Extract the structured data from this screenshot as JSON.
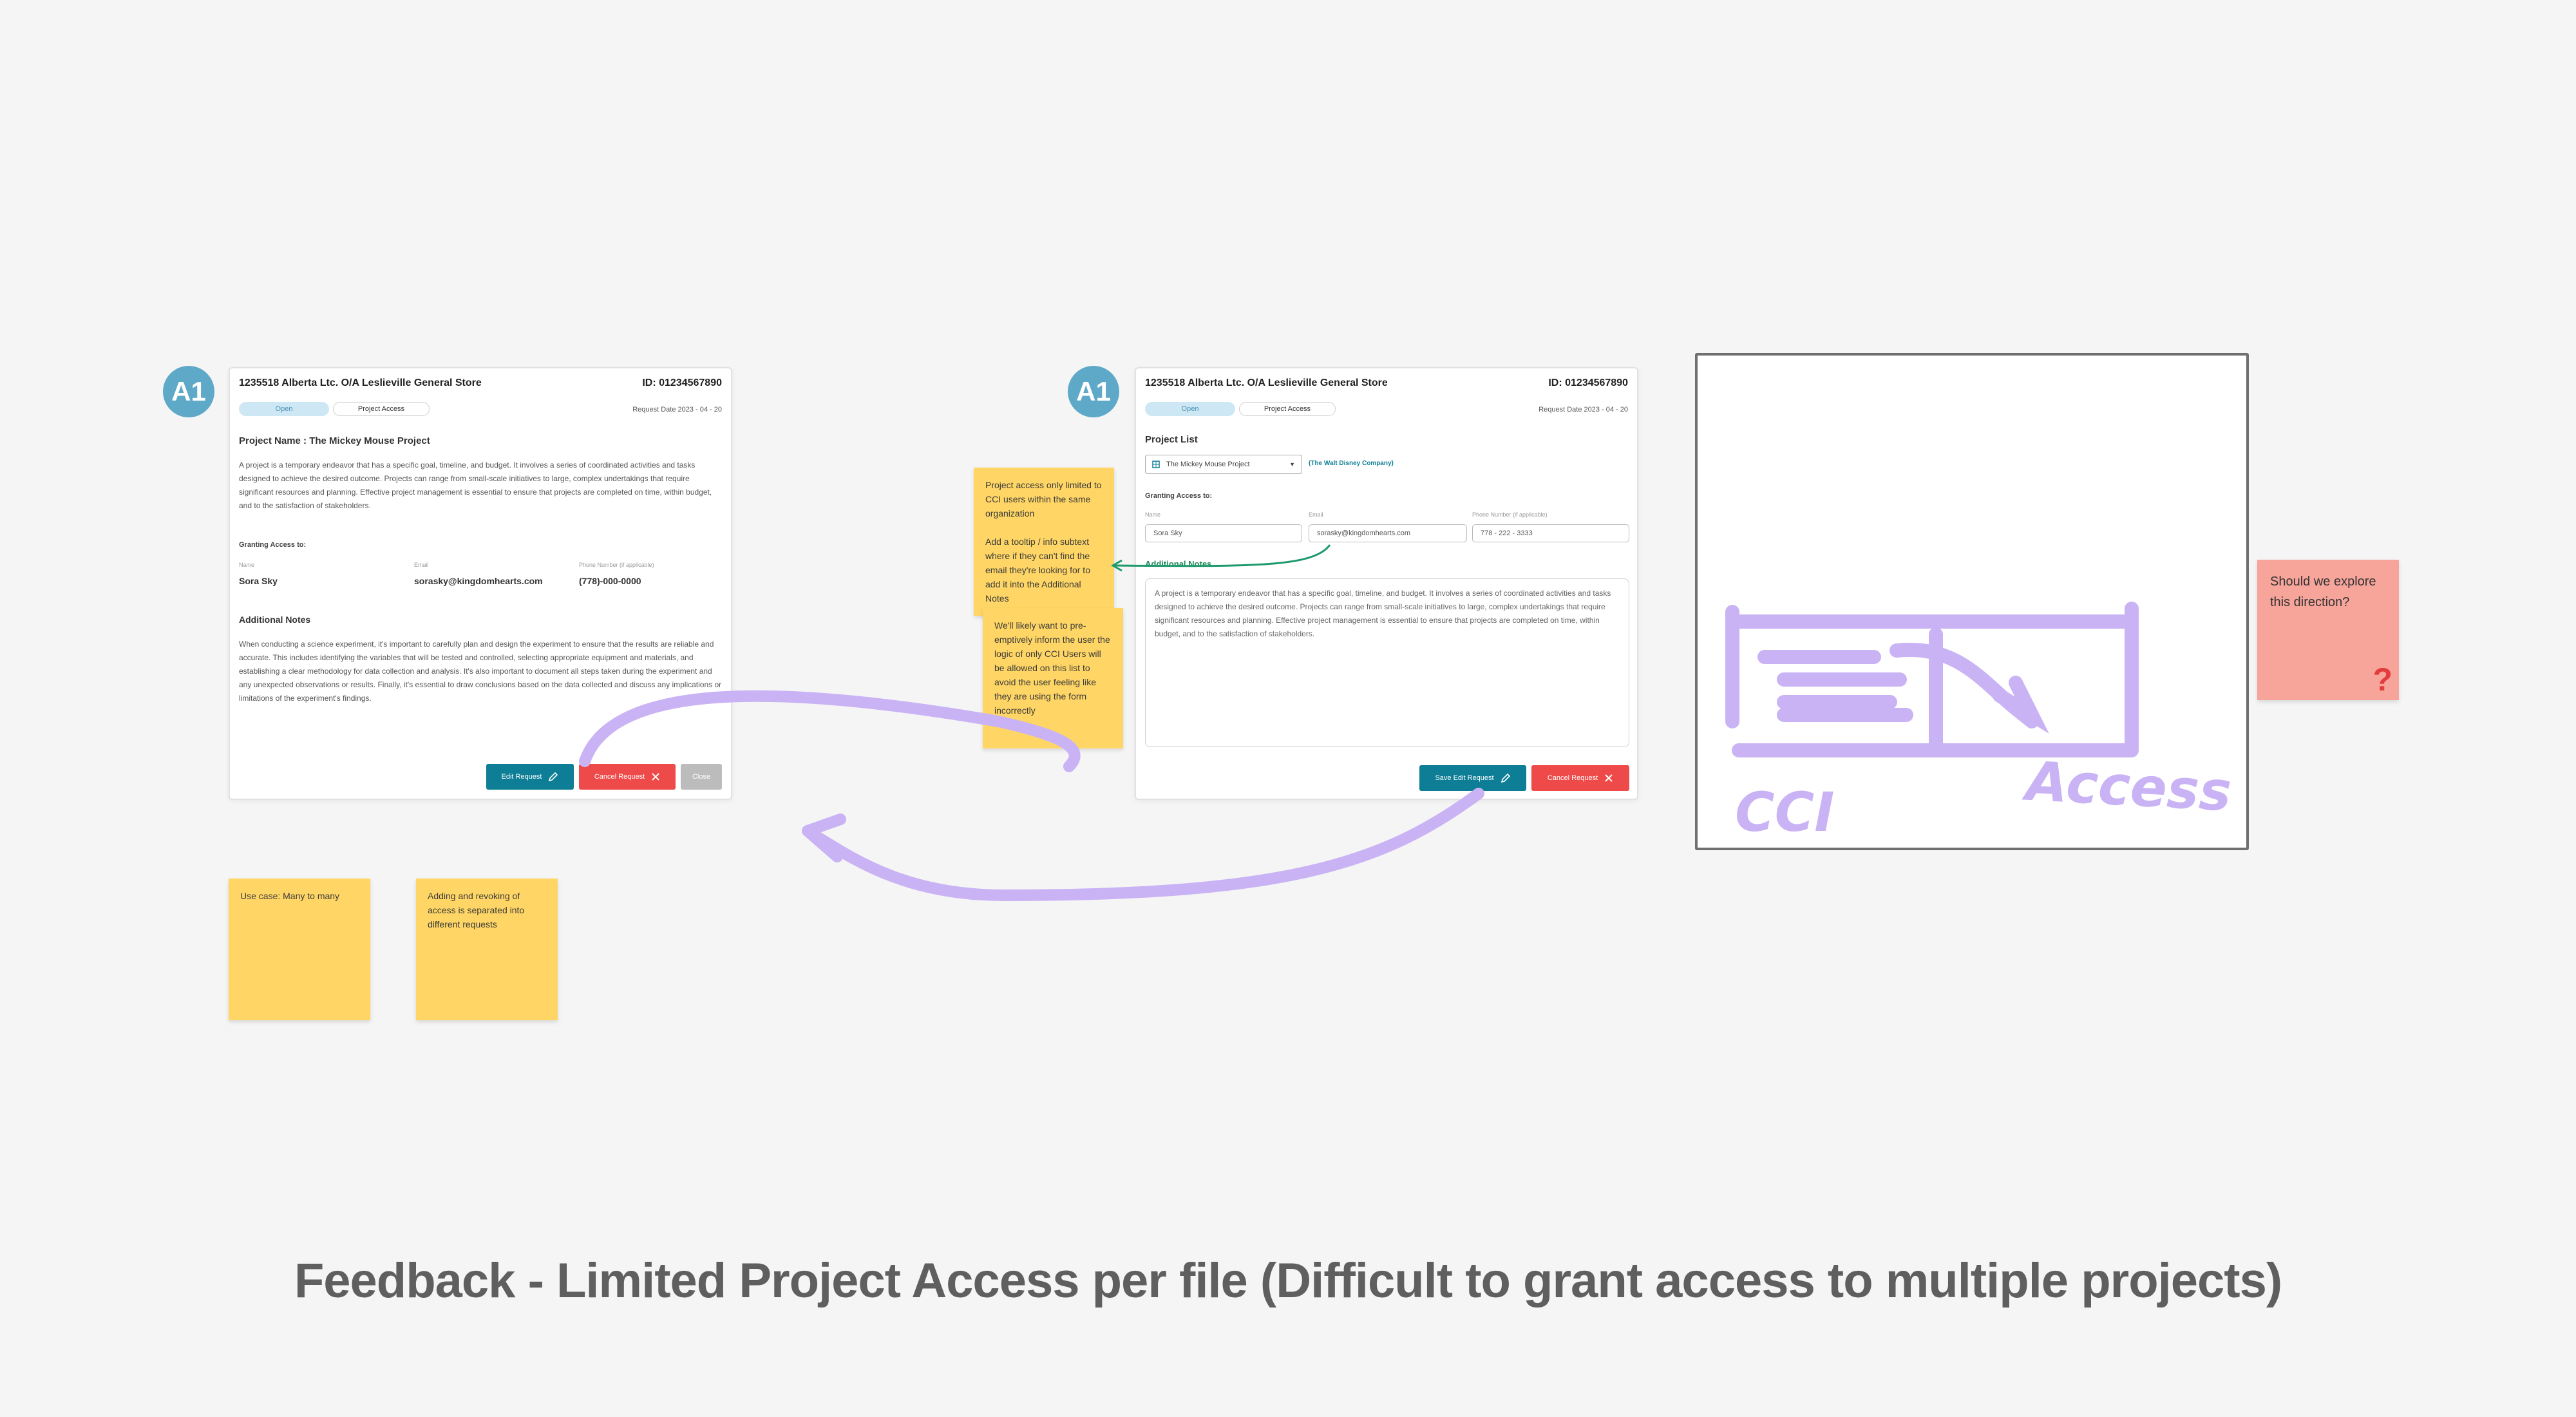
{
  "badges": {
    "left": "A1",
    "right": "A1"
  },
  "card_left": {
    "company": "1235518 Alberta Ltc. O/A Leslieville General Store",
    "request_id": "ID: 01234567890",
    "status": "Open",
    "type": "Project Access",
    "request_date": "Request Date  2023 - 04 - 20",
    "project_title": "Project Name : The Mickey Mouse Project",
    "project_desc": "A project is a temporary endeavor that has a specific goal, timeline, and budget. It involves a series of coordinated activities and tasks designed to achieve the desired outcome. Projects can range from small-scale initiatives to large, complex undertakings that require significant resources and planning. Effective project management is essential to ensure that projects are completed on time, within budget, and to the satisfaction of stakeholders.",
    "granting_label": "Granting Access to:",
    "name_label": "Name",
    "email_label": "Email",
    "phone_label": "Phone Number (if applicable)",
    "name_value": "Sora Sky",
    "email_value": "sorasky@kingdomhearts.com",
    "phone_value": "(778)-000-0000",
    "notes_title": "Additional Notes",
    "notes_text": "When conducting a science experiment, it's important to carefully plan and design the experiment to ensure that the results are reliable and accurate. This includes identifying the variables that will be tested and controlled, selecting appropriate equipment and materials, and establishing a clear methodology for data collection and analysis. It's also important to document all steps taken during the experiment and any unexpected observations or results. Finally, it's essential to draw conclusions based on the data collected and discuss any implications or limitations of the experiment's findings.",
    "edit_label": "Edit Request",
    "cancel_label": "Cancel Request",
    "close_label": "Close"
  },
  "card_right": {
    "company": "1235518 Alberta Ltc. O/A Leslieville General Store",
    "request_id": "ID: 01234567890",
    "status": "Open",
    "type": "Project Access",
    "request_date": "Request Date  2023 - 04 - 20",
    "project_list_title": "Project List",
    "project_select": "The Mickey Mouse Project",
    "company_link": "(The Walt Disney Company)",
    "granting_label": "Granting Access to:",
    "name_label": "Name",
    "email_label": "Email",
    "phone_label": "Phone Number (if applicable)",
    "name_value": "Sora Sky",
    "email_value": "sorasky@kingdomhearts.com",
    "phone_value": "778 - 222 - 3333",
    "notes_title": "Additional Notes",
    "notes_text": "A project is a temporary endeavor that has a specific goal, timeline, and budget. It involves a series of coordinated activities and tasks designed to achieve the desired outcome. Projects can range from small-scale initiatives to large, complex undertakings that require significant resources and planning. Effective project management is essential to ensure that projects are completed on time, within budget, and to the satisfaction of stakeholders.",
    "save_label": "Save Edit Request",
    "cancel_label": "Cancel Request"
  },
  "stickies": {
    "access_note": "Project access only limited to CCI users within the same organization\n\nAdd a tooltip / info subtext where if they can't find the email they're looking for to add it into the Additional Notes",
    "inform_note": "We'll likely want to pre-emptively inform the user the logic of only CCI Users will be allowed on this list to avoid the user feeling like they are using the form incorrectly",
    "use_case": "Use case: Many to many",
    "revoke_note": "Adding and revoking of access is separated into different requests",
    "question": "Should we explore this direction?"
  },
  "sketch": {
    "word_left": "CCI",
    "word_right": "Access",
    "question_mark": "?"
  },
  "headline": "Feedback - Limited Project Access per file (Difficult to grant access to multiple projects)",
  "colors": {
    "accent_teal": "#0d7e96",
    "danger": "#ef4a4a",
    "sticky": "#ffd665",
    "sketch": "#c9b3f5"
  }
}
